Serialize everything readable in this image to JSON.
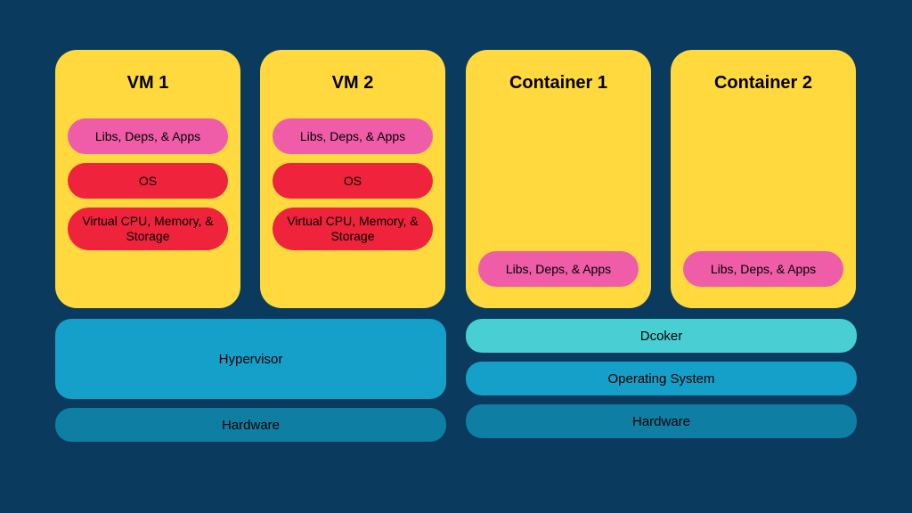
{
  "vm": {
    "boxes": [
      {
        "title": "VM 1",
        "libs": "Libs, Deps, & Apps",
        "os": "OS",
        "virt": "Virtual CPU, Memory, & Storage"
      },
      {
        "title": "VM 2",
        "libs": "Libs, Deps, & Apps",
        "os": "OS",
        "virt": "Virtual CPU, Memory, & Storage"
      }
    ],
    "hypervisor": "Hypervisor",
    "hardware": "Hardware"
  },
  "container": {
    "boxes": [
      {
        "title": "Container 1",
        "libs": "Libs, Deps, & Apps"
      },
      {
        "title": "Container 2",
        "libs": "Libs, Deps, & Apps"
      }
    ],
    "docker": "Dcoker",
    "os": "Operating System",
    "hardware": "Hardware"
  }
}
